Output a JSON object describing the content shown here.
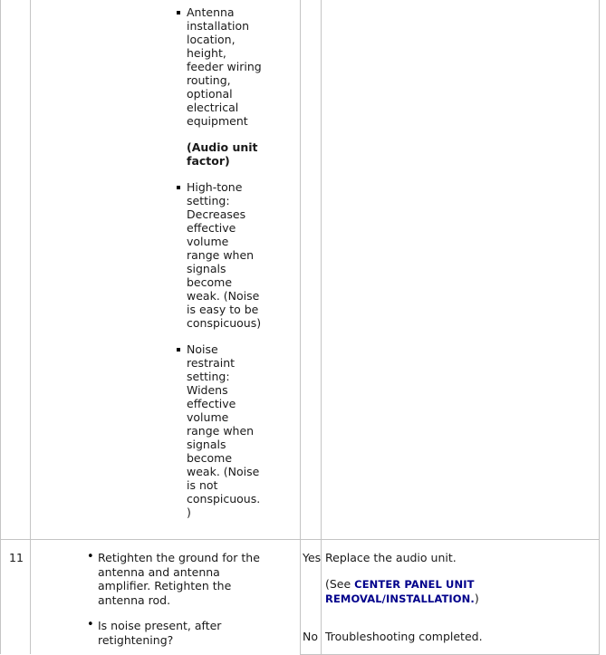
{
  "document": {
    "type": "troubleshooting-table",
    "link_color": "#00008b",
    "text_color": "#1a1a1a",
    "border_color": "#c4c4c4"
  },
  "columns": {
    "step_number": "",
    "inspection": "",
    "answer": "",
    "action": ""
  },
  "continued_cell": {
    "bullets": [
      "Antenna installation location, height, feeder wiring routing, optional electrical equipment"
    ],
    "bold_note": "(Audio unit factor)",
    "bullets_after": [
      "High-tone setting: Decreases effective volume range when signals become weak. (Noise is easy to be conspicuous)",
      "Noise restraint setting: Widens effective volume range when signals become weak. (Noise is not conspicuous.)"
    ]
  },
  "rows": [
    {
      "number": "11",
      "steps": [
        "Retighten the ground for the antenna and antenna amplifier. Retighten the antenna rod.",
        "Is noise present, after retightening?"
      ],
      "branches": [
        {
          "answer": "Yes",
          "action": "Replace the audio unit.",
          "reference": {
            "prefix": "(See ",
            "link": "CENTER PANEL UNIT REMOVAL/INSTALLATION.",
            "suffix": ")"
          }
        },
        {
          "answer": "No",
          "action": "Troubleshooting completed.",
          "reference": null
        }
      ]
    }
  ]
}
